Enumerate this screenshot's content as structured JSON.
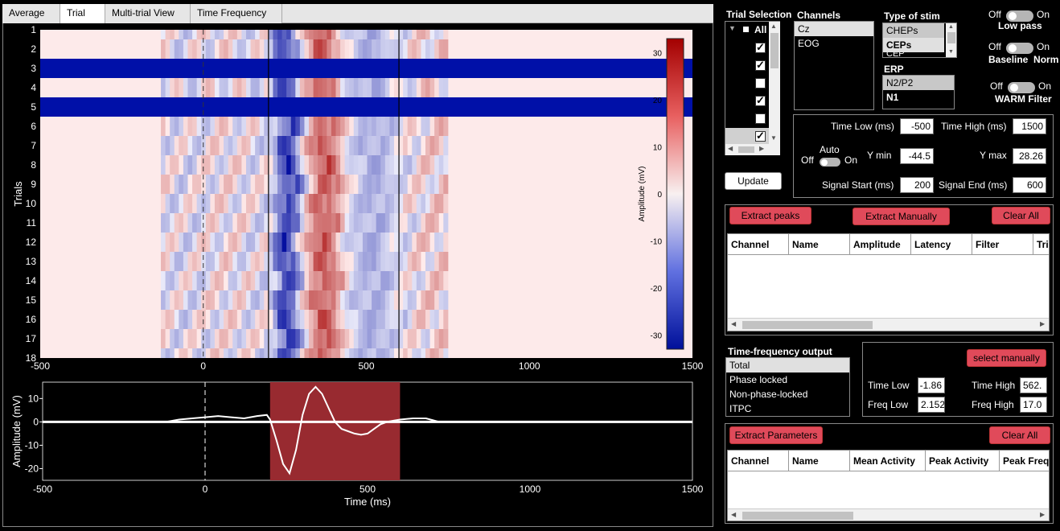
{
  "tabs": [
    "Average",
    "Trial",
    "Multi-trial View",
    "Time Frequency"
  ],
  "active_tab": "Trial",
  "heatmap": {
    "ylabel": "Trials",
    "xticks": [
      "-500",
      "0",
      "500",
      "1000",
      "1500"
    ],
    "yticks": [
      "1",
      "2",
      "3",
      "4",
      "5",
      "6",
      "7",
      "8",
      "9",
      "10",
      "11",
      "12",
      "13",
      "14",
      "15",
      "16",
      "17",
      "18"
    ],
    "colorbar_label": "Amplitude (mV)",
    "colorbar_ticks": [
      "30",
      "20",
      "10",
      "0",
      "-10",
      "-20",
      "-30"
    ],
    "rejected_trials": [
      3,
      5
    ],
    "signal_window_ms": [
      200,
      600
    ]
  },
  "erp": {
    "ylabel": "Amplitude (mV)",
    "xlabel": "Time (ms)",
    "yticks": [
      "10",
      "0",
      "-10",
      "-20"
    ],
    "xticks": [
      "-500",
      "0",
      "500",
      "1000",
      "1500"
    ],
    "window_color": "#982a30"
  },
  "chart_data": {
    "type": "line",
    "x": [
      -120,
      -80,
      -40,
      0,
      40,
      80,
      120,
      160,
      190,
      200,
      220,
      240,
      260,
      280,
      300,
      320,
      340,
      360,
      380,
      400,
      420,
      440,
      460,
      480,
      500,
      520,
      540,
      560,
      580,
      600,
      640,
      680,
      720
    ],
    "values": [
      0,
      1,
      1.5,
      2,
      2.5,
      2,
      1.5,
      2.5,
      3,
      1,
      -8,
      -18,
      -22,
      -12,
      3,
      12,
      15,
      12,
      6,
      0,
      -3,
      -4,
      -5,
      -5.5,
      -5,
      -3,
      -1,
      0,
      0.5,
      1,
      1.5,
      1.5,
      0
    ],
    "xlabel": "Time (ms)",
    "ylabel": "Amplitude (mV)",
    "xlim": [
      -500,
      1500
    ],
    "ylim": [
      -25,
      17
    ]
  },
  "trial_selection": {
    "title": "Trial Selection",
    "all_label": "All",
    "checks": [
      true,
      true,
      false,
      true,
      false,
      true
    ]
  },
  "channels": {
    "title": "Channels",
    "items": [
      "Cz",
      "EOG"
    ],
    "selected": 0
  },
  "stim": {
    "title": "Type of stim",
    "items": [
      "CHEPs",
      "CEPs",
      "CEP"
    ]
  },
  "erp_list": {
    "title": "ERP",
    "items": [
      "N2/P2",
      "N1"
    ]
  },
  "toggles": [
    {
      "off": "Off",
      "on": "On",
      "label": "Low pass"
    },
    {
      "off": "Off",
      "on": "On",
      "label": "Baseline  Norm"
    },
    {
      "off": "Off",
      "on": "On",
      "label": "WARM Filter"
    }
  ],
  "params": {
    "time_low_label": "Time Low (ms)",
    "time_low": "-500",
    "time_high_label": "Time High (ms)",
    "time_high": "1500",
    "auto_label": "Auto",
    "auto_off": "Off",
    "auto_on": "On",
    "ymin_label": "Y min",
    "ymin": "-44.5",
    "ymax_label": "Y max",
    "ymax": "28.26",
    "sig_start_label": "Signal Start (ms)",
    "sig_start": "200",
    "sig_end_label": "Signal End (ms)",
    "sig_end": "600"
  },
  "update_label": "Update",
  "peaks": {
    "extract_label": "Extract peaks",
    "extract_manual_label": "Extract Manually",
    "clear_label": "Clear All",
    "columns": [
      "Channel",
      "Name",
      "Amplitude",
      "Latency",
      "Filter",
      "Trial"
    ]
  },
  "tf": {
    "title": "Time-frequency output",
    "items": [
      "Total",
      "Phase locked",
      "Non-phase-locked",
      "ITPC"
    ],
    "select_manually_label": "select manually",
    "time_low_label": "Time Low",
    "time_low": "-1.86",
    "time_high_label": "Time High",
    "time_high": "562.",
    "freq_low_label": "Freq Low",
    "freq_low": "2.152",
    "freq_high_label": "Freq High",
    "freq_high": "17.0"
  },
  "params_table": {
    "extract_label": "Extract Parameters",
    "clear_label": "Clear All",
    "columns": [
      "Channel",
      "Name",
      "Mean Activity",
      "Peak Activity",
      "Peak Frequency"
    ]
  }
}
